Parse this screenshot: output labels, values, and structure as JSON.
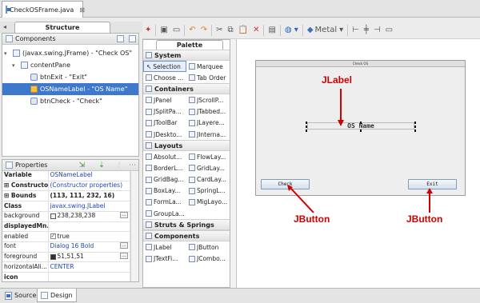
{
  "editor": {
    "tab_title": "CheckOSFrame.java",
    "close_glyph": "⊠"
  },
  "structure": {
    "tab_label": "Structure",
    "components_header": "Components",
    "tree": [
      {
        "label": "(javax.swing.JFrame) - \"Check OS\"",
        "depth": 0
      },
      {
        "label": "contentPane",
        "depth": 1
      },
      {
        "label": "btnExit - \"Exit\"",
        "depth": 2
      },
      {
        "label": "OSNameLabel - \"OS Name\"",
        "depth": 2,
        "selected": true
      },
      {
        "label": "btnCheck - \"Check\"",
        "depth": 2
      }
    ]
  },
  "properties": {
    "header": "Properties",
    "rows": [
      {
        "key": "Variable",
        "value": "OSNameLabel"
      },
      {
        "key": "Constructor",
        "value": "(Constructor properties)"
      },
      {
        "key": "Bounds",
        "value": "(113, 111, 232, 16)"
      },
      {
        "key": "Class",
        "value": "javax.swing.JLabel"
      },
      {
        "key": "background",
        "value": "238,238,238",
        "swatch": "#eeeeee"
      },
      {
        "key": "displayedMn...",
        "value": ""
      },
      {
        "key": "enabled",
        "value": "true"
      },
      {
        "key": "font",
        "value": "Dialog 16 Bold"
      },
      {
        "key": "foreground",
        "value": "51,51,51",
        "swatch": "#333333"
      },
      {
        "key": "horizontalAli...",
        "value": "CENTER"
      },
      {
        "key": "icon",
        "value": ""
      }
    ]
  },
  "toolbar": {
    "look_and_feel": "Metal"
  },
  "palette": {
    "tab_label": "Palette",
    "categories": [
      {
        "name": "System",
        "items": [
          "Selection",
          "Marquee",
          "Choose ...",
          "Tab Order"
        ]
      },
      {
        "name": "Containers",
        "items": [
          "JPanel",
          "JScrollP...",
          "JSplitPa...",
          "JTabbed...",
          "JToolBar",
          "JLayere...",
          "JDeskto...",
          "JInterna..."
        ]
      },
      {
        "name": "Layouts",
        "items": [
          "Absolut...",
          "FlowLay...",
          "BorderL...",
          "GridLay...",
          "GridBag...",
          "CardLay...",
          "BoxLay...",
          "SpringL...",
          "FormLa...",
          "MigLayo...",
          "GroupLa..."
        ]
      },
      {
        "name": "Struts & Springs",
        "items": []
      },
      {
        "name": "Components",
        "items": [
          "JLabel",
          "JButton",
          "JTextFi...",
          "JCombo..."
        ]
      }
    ]
  },
  "design": {
    "frame_title": "Check OS",
    "label_text": "OS Name",
    "check_button": "Check",
    "exit_button": "Exit",
    "annotations": {
      "jlabel": "JLabel",
      "jbutton_left": "JButton",
      "jbutton_right": "JButton"
    },
    "annotation_color": "#d10000"
  },
  "bottom_tabs": {
    "source": "Source",
    "design": "Design"
  }
}
